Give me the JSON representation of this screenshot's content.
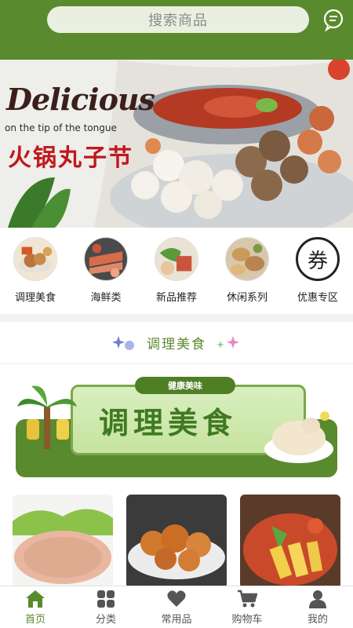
{
  "search": {
    "placeholder": "搜索商品"
  },
  "banner": {
    "title": "Delicious",
    "subtitle": "on the tip of the tongue",
    "cn_title": "火锅丸子节"
  },
  "categories": [
    {
      "label": "调理美食"
    },
    {
      "label": "海鲜类"
    },
    {
      "label": "新品推荐"
    },
    {
      "label": "休闲系列"
    },
    {
      "label": "优惠专区",
      "glyph": "券"
    }
  ],
  "section": {
    "title": "调理美食",
    "promo": {
      "ribbon": "健康美味",
      "big": "调理美食"
    }
  },
  "tabs": [
    {
      "label": "首页",
      "icon": "home-icon",
      "active": true
    },
    {
      "label": "分类",
      "icon": "grid-icon"
    },
    {
      "label": "常用品",
      "icon": "heart-icon"
    },
    {
      "label": "购物车",
      "icon": "cart-icon"
    },
    {
      "label": "我的",
      "icon": "user-icon"
    }
  ],
  "colors": {
    "brand": "#5a8a2e",
    "accent": "#c0181c"
  }
}
